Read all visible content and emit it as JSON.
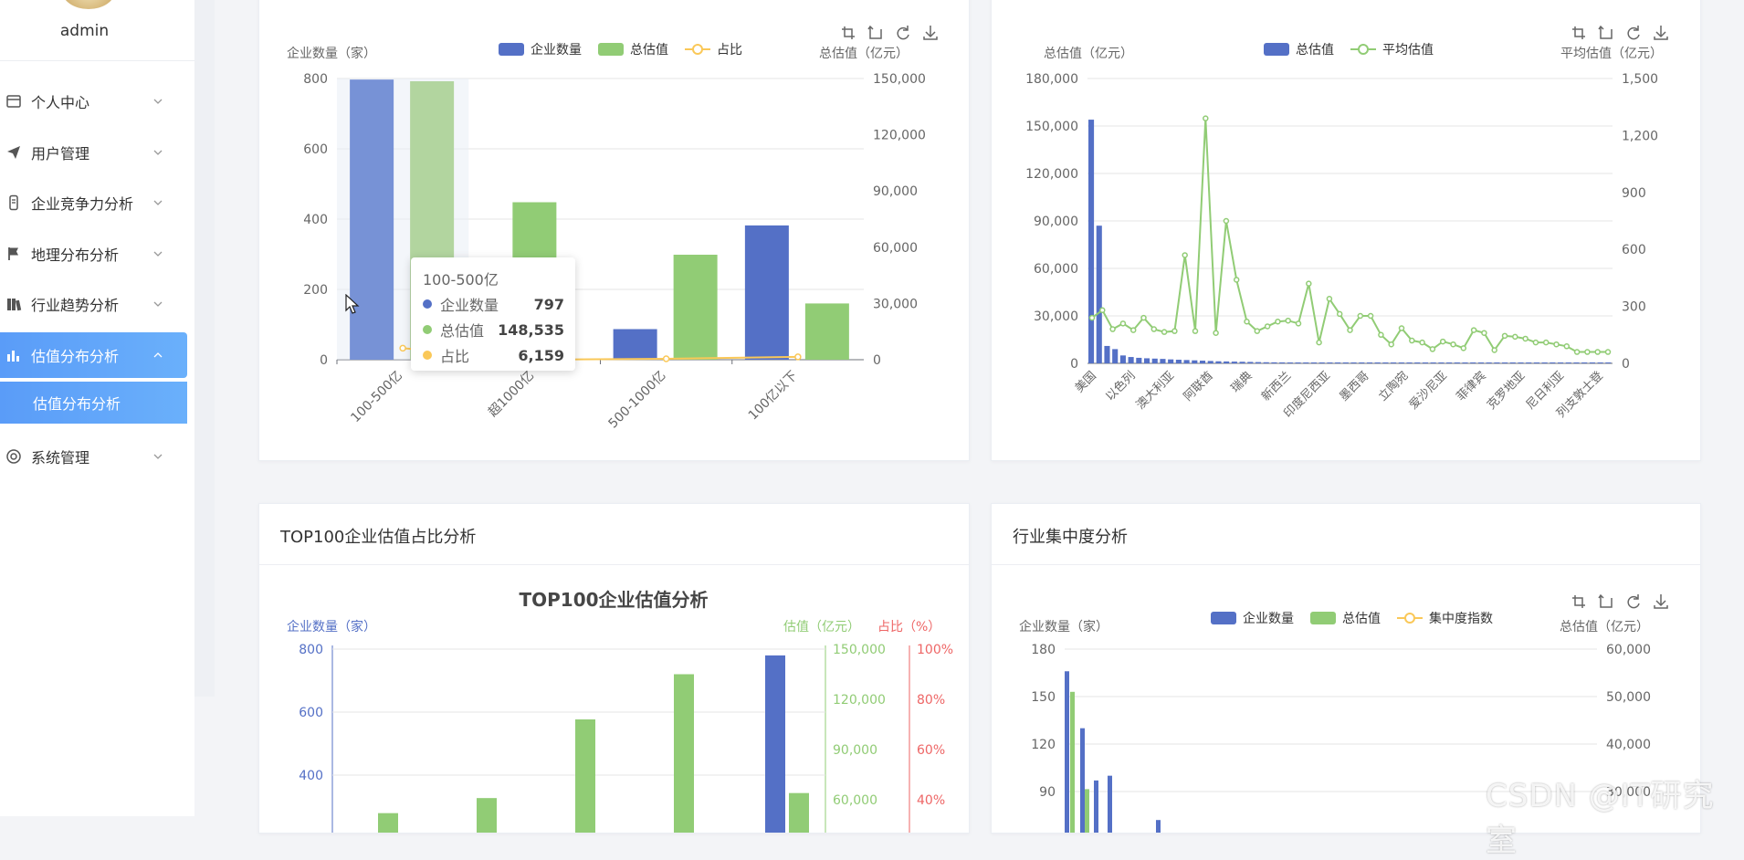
{
  "sidebar": {
    "username": "admin",
    "items": [
      {
        "label": "个人中心",
        "icon": "profile-icon"
      },
      {
        "label": "用户管理",
        "icon": "send-icon"
      },
      {
        "label": "企业竞争力分析",
        "icon": "device-icon"
      },
      {
        "label": "地理分布分析",
        "icon": "flag-icon"
      },
      {
        "label": "行业趋势分析",
        "icon": "books-icon"
      },
      {
        "label": "估值分布分析",
        "icon": "bar-chart-icon"
      },
      {
        "label": "系统管理",
        "icon": "lifebuoy-icon"
      }
    ],
    "active_index": 5,
    "submenu_label": "估值分布分析",
    "accent_color": "#5a9cf8"
  },
  "cards": {
    "card3_title": "TOP100企业估值占比分析",
    "card4_title": "行业集中度分析"
  },
  "toolbox_icons": [
    "zoom-icon",
    "zoom-reset-icon",
    "restore-icon",
    "download-icon"
  ],
  "colors": {
    "blue": "#5470c6",
    "green": "#91cc75",
    "yellow": "#fac858",
    "red": "#ee6666"
  },
  "tooltip": {
    "title": "100-500亿",
    "rows": [
      {
        "name": "企业数量",
        "value": "797",
        "color": "#5470c6"
      },
      {
        "name": "总估值",
        "value": "148,535",
        "color": "#91cc75"
      },
      {
        "name": "占比",
        "value": "6,159",
        "color": "#fac858"
      }
    ]
  },
  "watermark": "CSDN @IT研究室",
  "chart_data": [
    {
      "id": "chart1",
      "type": "bar",
      "legend": [
        "企业数量",
        "总估值",
        "占比"
      ],
      "legend_position": "top-center",
      "y_left_label": "企业数量（家）",
      "y_right_label": "总估值（亿元）",
      "y_left_ticks": [
        "0",
        "200",
        "400",
        "600",
        "800"
      ],
      "y_right_ticks": [
        "0",
        "30,000",
        "60,000",
        "90,000",
        "120,000",
        "150,000"
      ],
      "ylim_left": [
        0,
        800
      ],
      "ylim_right": [
        0,
        150000
      ],
      "categories": [
        "100-500亿",
        "超1000亿",
        "500-1000亿",
        "100亿以下"
      ],
      "series": [
        {
          "name": "企业数量",
          "type": "bar",
          "axis": "left",
          "values": [
            797,
            0,
            87,
            382
          ]
        },
        {
          "name": "总估值",
          "type": "bar",
          "axis": "right",
          "values": [
            148535,
            84000,
            56000,
            30000
          ]
        },
        {
          "name": "占比",
          "type": "line",
          "axis": "right",
          "values": [
            6159,
            0,
            500,
            1500
          ]
        }
      ]
    },
    {
      "id": "chart2",
      "type": "bar",
      "legend": [
        "总估值",
        "平均估值"
      ],
      "legend_position": "top-center",
      "y_left_label": "总估值（亿元）",
      "y_right_label": "平均估值（亿元）",
      "y_left_ticks": [
        "0",
        "30,000",
        "60,000",
        "90,000",
        "120,000",
        "150,000",
        "180,000"
      ],
      "y_right_ticks": [
        "0",
        "300",
        "600",
        "900",
        "1,200",
        "1,500"
      ],
      "ylim_left": [
        0,
        180000
      ],
      "ylim_right": [
        0,
        1500
      ],
      "visible_x_labels": [
        "美国",
        "以色列",
        "澳大利亚",
        "阿联酋",
        "瑞典",
        "新西兰",
        "印度尼西亚",
        "墨西哥",
        "立陶宛",
        "爱沙尼亚",
        "菲律宾",
        "克罗地亚",
        "尼日利亚",
        "列支敦士登"
      ],
      "series": [
        {
          "name": "总估值",
          "type": "bar",
          "axis": "left",
          "values": [
            154000,
            87000,
            11000,
            9000,
            5000,
            4000,
            3500,
            3200,
            3000,
            2800,
            2500,
            2300,
            2100,
            1900,
            1700,
            1500,
            1300,
            1200,
            1100,
            1000,
            900,
            800,
            700,
            650,
            600,
            550,
            500,
            450,
            420,
            400,
            380,
            360,
            340,
            320,
            300,
            280,
            260,
            240,
            220,
            200,
            190,
            180,
            170,
            160,
            150,
            140,
            130,
            120,
            110,
            100,
            95,
            90,
            85,
            80,
            75,
            70,
            65,
            60,
            55,
            50,
            45,
            40,
            35,
            30,
            25,
            20
          ]
        },
        {
          "name": "平均估值",
          "type": "line",
          "axis": "right",
          "values": [
            240,
            280,
            180,
            210,
            175,
            240,
            180,
            165,
            170,
            570,
            170,
            1290,
            160,
            750,
            440,
            220,
            170,
            195,
            220,
            225,
            210,
            420,
            110,
            340,
            260,
            175,
            250,
            250,
            150,
            100,
            185,
            120,
            110,
            75,
            115,
            100,
            80,
            175,
            160,
            70,
            145,
            140,
            130,
            110,
            110,
            100,
            90,
            60,
            60,
            60,
            60
          ]
        }
      ]
    },
    {
      "id": "chart3",
      "type": "bar",
      "title": "TOP100企业估值分析",
      "y_left_label": "企业数量（家）",
      "y_right_label": "估值（亿元）",
      "y_right2_label": "占比（%）",
      "y_left_ticks": [
        "400",
        "600",
        "800"
      ],
      "y_right_ticks": [
        "60,000",
        "90,000",
        "120,000",
        "150,000"
      ],
      "y_right2_ticks": [
        "40%",
        "60%",
        "80%",
        "100%"
      ],
      "ylim_left": [
        0,
        800
      ],
      "ylim_right": [
        0,
        150000
      ],
      "series": [
        {
          "name": "企业数量",
          "type": "bar",
          "axis": "left",
          "values": [
            0,
            0,
            0,
            0,
            780
          ]
        },
        {
          "name": "估值",
          "type": "bar",
          "axis": "right",
          "values": [
            52000,
            61000,
            108000,
            135000,
            64000
          ]
        }
      ]
    },
    {
      "id": "chart4",
      "type": "bar",
      "legend": [
        "企业数量",
        "总估值",
        "集中度指数"
      ],
      "legend_position": "top-center",
      "y_left_label": "企业数量（家）",
      "y_right_label": "总估值（亿元）",
      "y_left_ticks": [
        "90",
        "120",
        "150",
        "180"
      ],
      "y_right_ticks": [
        "30,000",
        "40,000",
        "50,000",
        "60,000"
      ],
      "ylim_left": [
        0,
        180
      ],
      "ylim_right": [
        0,
        60000
      ],
      "series": [
        {
          "name": "企业数量",
          "type": "bar",
          "axis": "left",
          "values": [
            166,
            130,
            97,
            100,
            72
          ]
        },
        {
          "name": "总估值",
          "type": "bar",
          "axis": "right",
          "values": [
            51000,
            30500
          ]
        }
      ]
    }
  ]
}
